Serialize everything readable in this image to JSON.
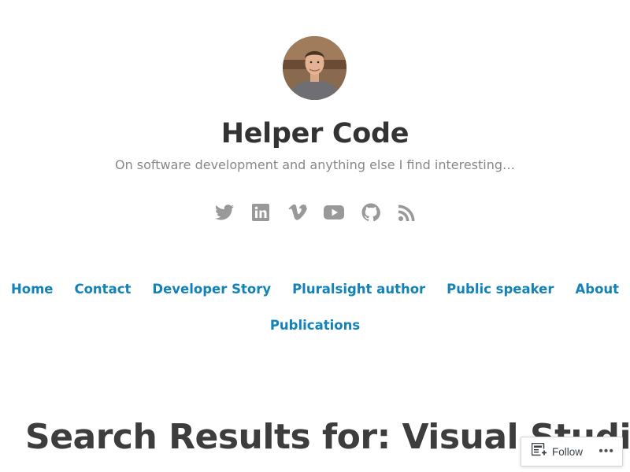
{
  "header": {
    "avatar_alt": "Profile photo",
    "site_title": "Helper Code",
    "tagline": "On software development and anything else I find interesting…"
  },
  "social_icons": [
    "twitter-icon",
    "linkedin-icon",
    "vimeo-icon",
    "youtube-icon",
    "github-icon",
    "rss-icon"
  ],
  "nav": {
    "items": [
      {
        "label": "Home"
      },
      {
        "label": "Contact"
      },
      {
        "label": "Developer Story"
      },
      {
        "label": "Pluralsight author"
      },
      {
        "label": "Public speaker"
      },
      {
        "label": "About"
      },
      {
        "label": "Publications"
      }
    ]
  },
  "main": {
    "search_title": "Search Results for: Visual Studio tip: paste json/xml file as class"
  },
  "follow_widget": {
    "label": "Follow",
    "more": "•••"
  },
  "colors": {
    "link": "#1282b8",
    "title": "#333333",
    "tagline": "#888888",
    "icon": "#999999"
  }
}
